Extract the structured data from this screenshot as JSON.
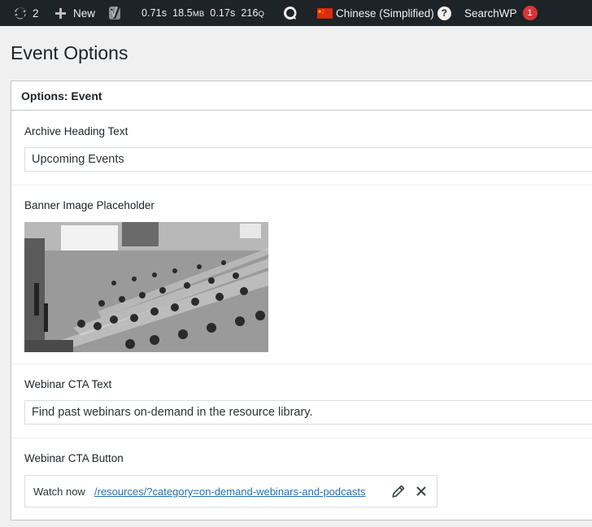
{
  "admin_bar": {
    "updates_count": "2",
    "new_label": "New",
    "query_monitor": {
      "time1": "0.71s",
      "memory_value": "18.5",
      "memory_unit": "MB",
      "time2": "0.17s",
      "queries_value": "216",
      "queries_unit": "Q"
    },
    "language_label": "Chinese (Simplified)",
    "searchwp_label": "SearchWP",
    "searchwp_badge": "1"
  },
  "page_title": "Event Options",
  "postbox_title": "Options: Event",
  "fields": {
    "archive_heading": {
      "label": "Archive Heading Text",
      "value": "Upcoming Events"
    },
    "banner_image": {
      "label": "Banner Image Placeholder"
    },
    "webinar_cta_text": {
      "label": "Webinar CTA Text",
      "value": "Find past webinars on-demand in the resource library."
    },
    "webinar_cta_button": {
      "label": "Webinar CTA Button",
      "link_title": "Watch now",
      "link_url": "/resources/?category=on-demand-webinars-and-podcasts"
    }
  },
  "icons": {
    "updates": "refresh-icon",
    "new": "plus-icon",
    "yoast": "yoast-icon",
    "translate": "speech-bubble-icon",
    "flag": "china-flag-icon",
    "help": "question-icon",
    "edit": "pencil-icon",
    "remove": "close-icon"
  },
  "colors": {
    "admin_bar_bg": "#1d2327",
    "badge": "#d63638",
    "link": "#2271b1",
    "flag_red": "#de2910",
    "flag_yellow": "#ffde00"
  }
}
